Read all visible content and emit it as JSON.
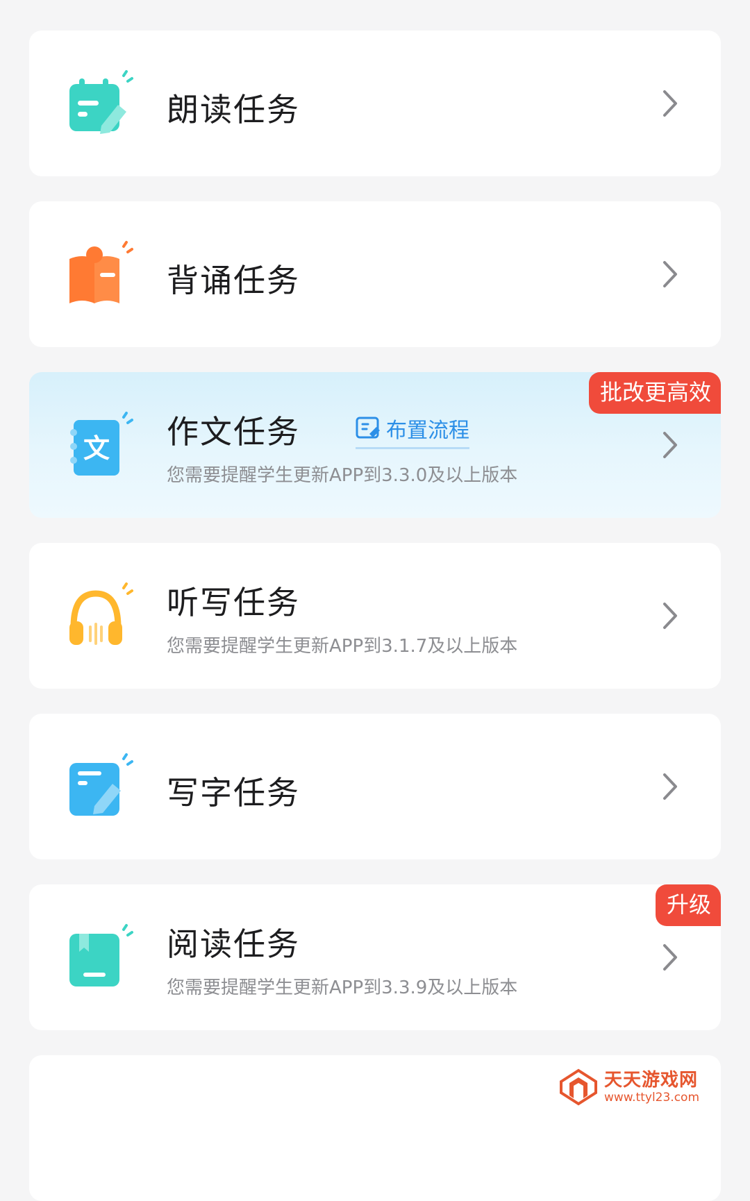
{
  "tasks": [
    {
      "title": "朗读任务",
      "subtitle": "",
      "icon": "calendar-pencil-icon",
      "color": "#3cd4c4"
    },
    {
      "title": "背诵任务",
      "subtitle": "",
      "icon": "open-book-icon",
      "color": "#ff7a33"
    },
    {
      "title": "作文任务",
      "subtitle": "您需要提醒学生更新APP到3.3.0及以上版本",
      "icon": "notebook-wen-icon",
      "color": "#3cb6f2",
      "badge": "批改更高效",
      "link": "布置流程"
    },
    {
      "title": "听写任务",
      "subtitle": "您需要提醒学生更新APP到3.1.7及以上版本",
      "icon": "headphones-icon",
      "color": "#ffb72d"
    },
    {
      "title": "写字任务",
      "subtitle": "",
      "icon": "note-pencil-icon",
      "color": "#3cb6f2"
    },
    {
      "title": "阅读任务",
      "subtitle": "您需要提醒学生更新APP到3.3.9及以上版本",
      "icon": "book-bookmark-icon",
      "color": "#3cd4c4",
      "badge": "升级"
    }
  ],
  "watermark": {
    "name": "天天游戏网",
    "url": "www.ttyl23.com"
  },
  "colors": {
    "badge": "#f04b3b",
    "link": "#2c8fe7",
    "chevron": "#8a8a8e"
  }
}
